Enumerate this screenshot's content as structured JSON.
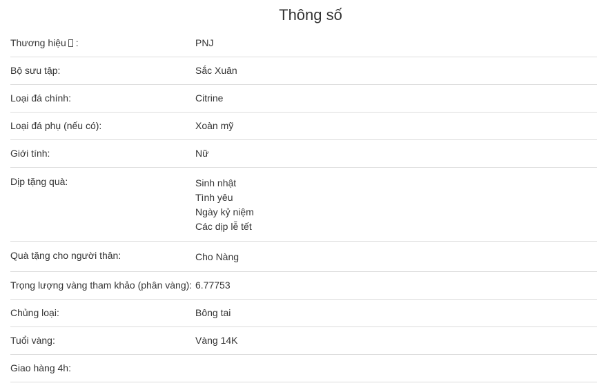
{
  "title": "Thông số",
  "specs": [
    {
      "label": "Thương hiệu",
      "suffix": " :",
      "value": "PNJ"
    },
    {
      "label": "Bộ sưu tập:",
      "value": "Sắc Xuân"
    },
    {
      "label": "Loại đá chính:",
      "value": "Citrine"
    },
    {
      "label": "Loại đá phụ (nếu có):",
      "value": "Xoàn mỹ"
    },
    {
      "label": "Giới tính:",
      "value": "Nữ"
    },
    {
      "label": "Dịp tặng quà:",
      "values": [
        "Sinh nhật",
        "Tình yêu",
        "Ngày kỷ niệm",
        "Các dịp lễ tết"
      ]
    },
    {
      "label": "Quà tặng cho người thân:",
      "value": "Cho Nàng"
    },
    {
      "label": "Trọng lượng vàng tham khảo (phân vàng):",
      "value": "6.77753"
    },
    {
      "label": "Chủng loại:",
      "value": "Bông tai"
    },
    {
      "label": "Tuổi vàng:",
      "value": "Vàng 14K"
    },
    {
      "label": "Giao hàng 4h:",
      "value": ""
    }
  ]
}
